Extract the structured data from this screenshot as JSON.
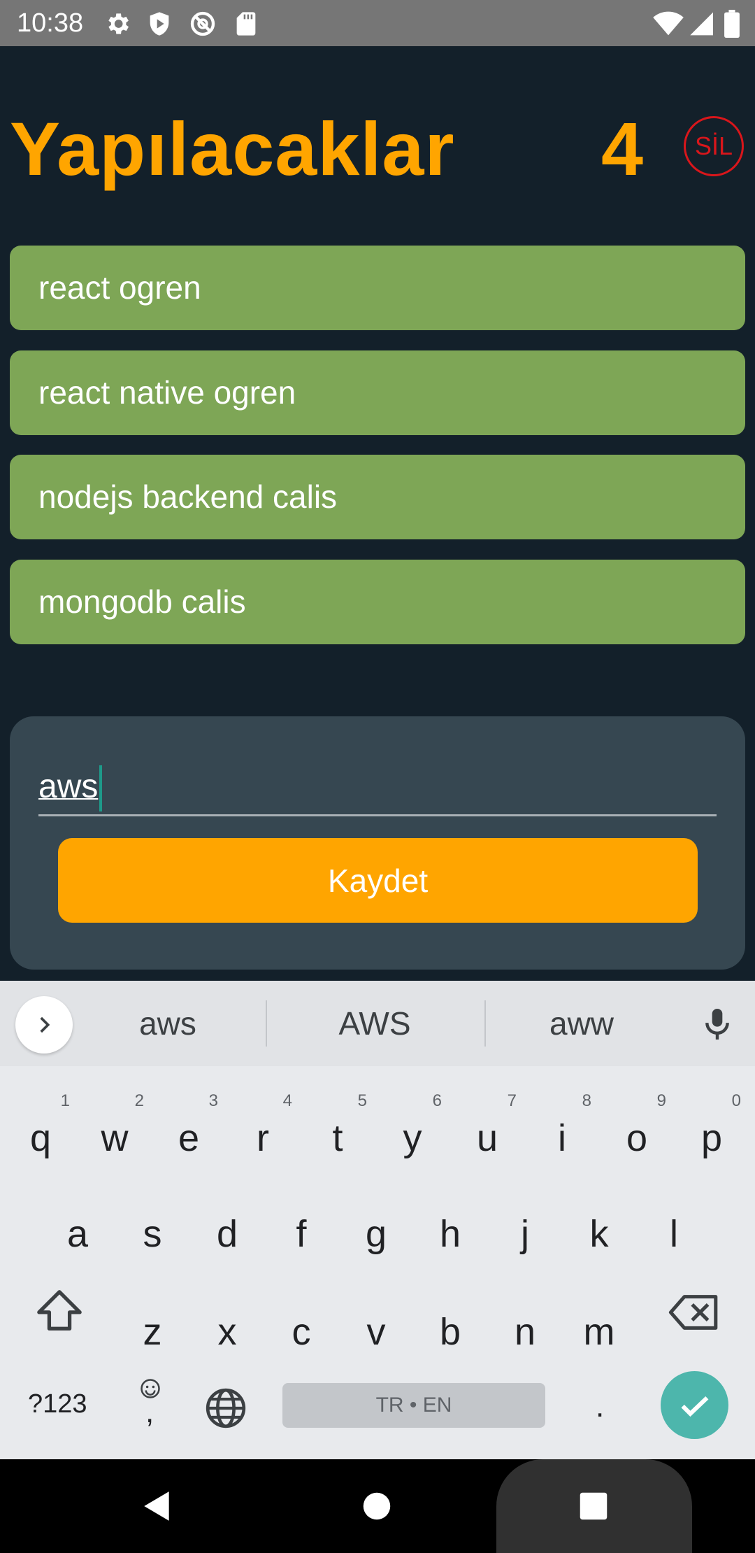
{
  "status_bar": {
    "time": "10:38",
    "left_icons": [
      "gear-icon",
      "shield-play-icon",
      "no-sync-icon",
      "sd-card-icon"
    ],
    "right_icons": [
      "wifi-icon",
      "signal-icon",
      "battery-icon"
    ]
  },
  "header": {
    "title": "Yapılacaklar",
    "count": "4",
    "delete_label": "SİL"
  },
  "todos": [
    {
      "label": "react ogren"
    },
    {
      "label": "react native ogren"
    },
    {
      "label": "nodejs backend calis"
    },
    {
      "label": "mongodb calis"
    }
  ],
  "form": {
    "input_value": "aws",
    "save_label": "Kaydet"
  },
  "keyboard": {
    "suggestions": [
      "aws",
      "AWS",
      "aww"
    ],
    "row1": [
      "q",
      "w",
      "e",
      "r",
      "t",
      "y",
      "u",
      "i",
      "o",
      "p"
    ],
    "row1_hints": [
      "1",
      "2",
      "3",
      "4",
      "5",
      "6",
      "7",
      "8",
      "9",
      "0"
    ],
    "row2": [
      "a",
      "s",
      "d",
      "f",
      "g",
      "h",
      "j",
      "k",
      "l"
    ],
    "row3": [
      "z",
      "x",
      "c",
      "v",
      "b",
      "n",
      "m"
    ],
    "symbols_label": "?123",
    "comma_label": ",",
    "period_label": ".",
    "space_label": "TR • EN"
  },
  "colors": {
    "accent": "#ffa500",
    "todo_bg": "#7ea656",
    "app_bg": "#13202a",
    "card_bg": "#364751",
    "delete": "#d9161b"
  }
}
